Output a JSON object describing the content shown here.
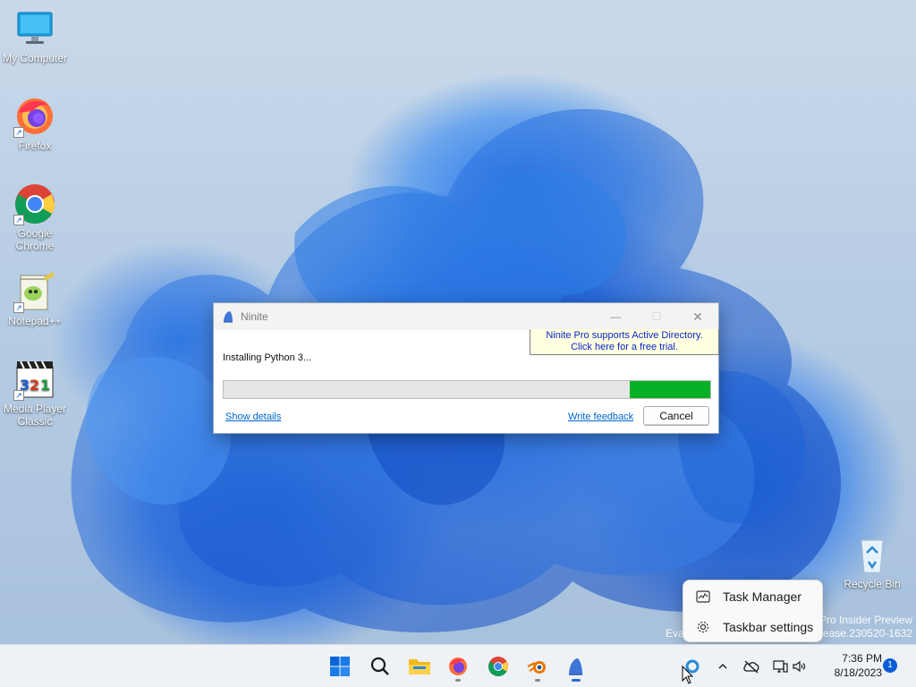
{
  "desktop": {
    "icons": [
      {
        "label_lines": [
          "My Computer"
        ]
      },
      {
        "label_lines": [
          "Firefox"
        ]
      },
      {
        "label_lines": [
          "Google",
          "Chrome"
        ]
      },
      {
        "label_lines": [
          "Notepad++"
        ]
      },
      {
        "label_lines": [
          "Media Player",
          "Classic"
        ]
      },
      {
        "label_lines": [
          "Recycle Bin"
        ]
      }
    ],
    "watermark": {
      "line1_left": "Eva",
      "line1_right": "Pro Insider Preview",
      "line2_right": "elease.230520-1632"
    }
  },
  "ninite": {
    "title": "Ninite",
    "promo_line1": "Ninite Pro supports Active Directory.",
    "promo_line2": "Click here for a free trial.",
    "status": "Installing Python 3...",
    "progress_fraction": 0.165,
    "show_details": "Show details",
    "write_feedback": "Write feedback",
    "cancel": "Cancel",
    "controls": {
      "minimize": "—",
      "maximize": "☐",
      "close": "✕"
    }
  },
  "context_menu": {
    "items": [
      {
        "label": "Task Manager",
        "icon": "task-manager-icon"
      },
      {
        "label": "Taskbar settings",
        "icon": "settings-gear-icon"
      }
    ]
  },
  "taskbar": {
    "apps": [
      "start",
      "search",
      "file-explorer",
      "firefox",
      "chrome",
      "blender",
      "ninite"
    ],
    "clock_time": "7:36 PM",
    "clock_date": "8/18/2023",
    "notification_count": "1"
  },
  "colors": {
    "progress_fill": "#06b025",
    "link": "#0066cc",
    "promo_text": "#0a26c8",
    "promo_bg": "#ffffe1",
    "accent": "#0b5cd6"
  }
}
